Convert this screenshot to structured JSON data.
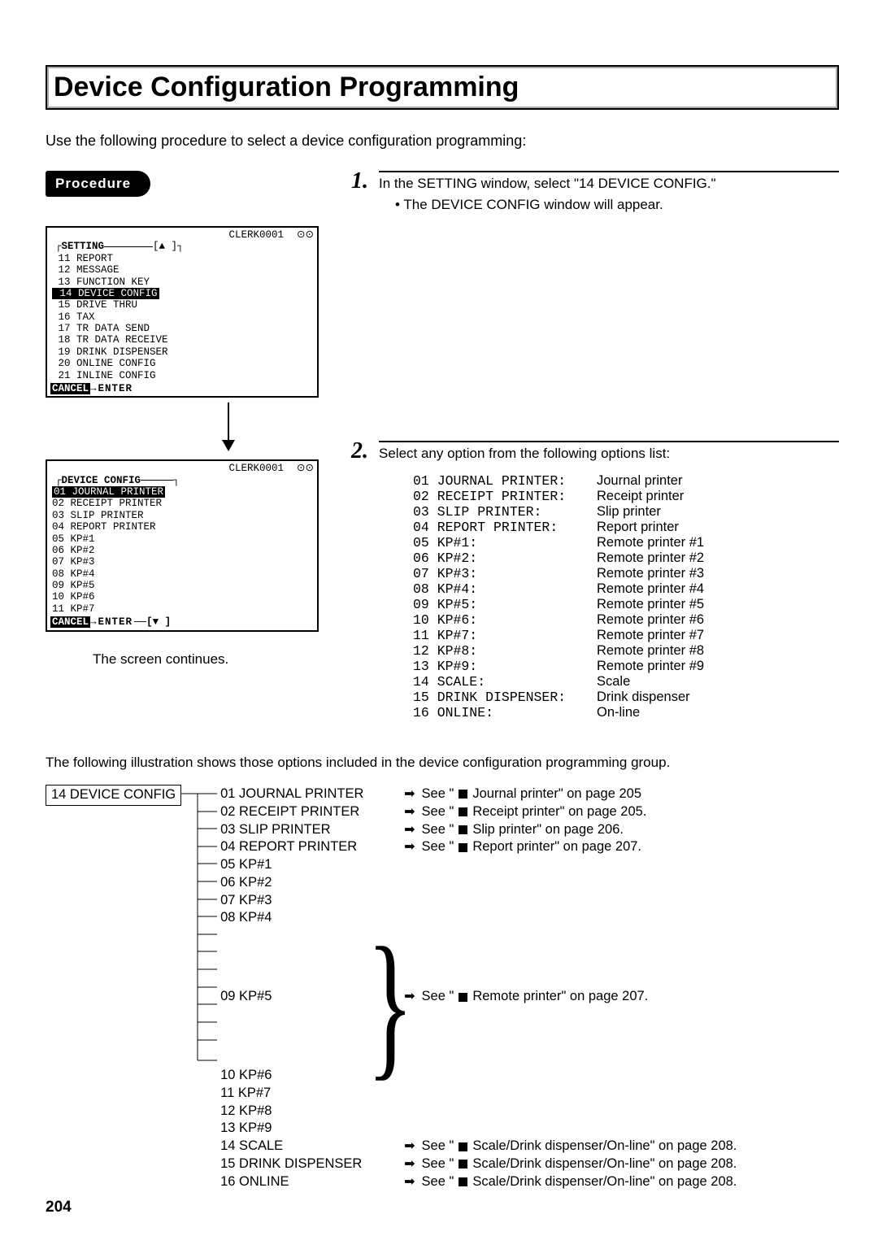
{
  "title": "Device Configuration Programming",
  "intro": "Use the following procedure to select a device configuration programming:",
  "procedure_label": "Procedure",
  "clerk_id": "CLERK0001",
  "rec_icon": "⊙⊙",
  "terminal1": {
    "title": "SETTING",
    "scroll": "[▲ ]",
    "items": [
      "11 REPORT",
      "12 MESSAGE",
      "13 FUNCTION KEY",
      "14 DEVICE CONFIG",
      "15 DRIVE THRU",
      "16 TAX",
      "17 TR DATA SEND",
      "18 TR DATA RECEIVE",
      "19 DRINK DISPENSER",
      "20 ONLINE CONFIG",
      "21 INLINE CONFIG"
    ],
    "selected_index": 3,
    "cancel": "CANCEL",
    "enter": "ENTER"
  },
  "terminal2": {
    "title": "DEVICE CONFIG",
    "scroll": "[▼ ]",
    "items": [
      "01 JOURNAL PRINTER",
      "02 RECEIPT PRINTER",
      "03 SLIP PRINTER",
      "04 REPORT PRINTER",
      "05 KP#1",
      "06 KP#2",
      "07 KP#3",
      "08 KP#4",
      "09 KP#5",
      "10 KP#6",
      "11 KP#7"
    ],
    "selected_index": 0,
    "cancel": "CANCEL",
    "enter": "ENTER"
  },
  "screen_continues": "The screen continues.",
  "step1": {
    "num": "1.",
    "text_a": "In the SETTING window, select \"14 DEVICE CONFIG.\"",
    "bullet": "The DEVICE CONFIG window will appear."
  },
  "step2": {
    "num": "2.",
    "text_a": "Select any option from the following options list:"
  },
  "options": [
    {
      "code": "01 JOURNAL PRINTER:",
      "desc": "Journal printer"
    },
    {
      "code": "02 RECEIPT PRINTER:",
      "desc": "Receipt printer"
    },
    {
      "code": "03 SLIP PRINTER:",
      "desc": "Slip printer"
    },
    {
      "code": "04 REPORT PRINTER:",
      "desc": "Report printer"
    },
    {
      "code": "05 KP#1:",
      "desc": "Remote printer #1"
    },
    {
      "code": "06 KP#2:",
      "desc": "Remote printer #2"
    },
    {
      "code": "07 KP#3:",
      "desc": "Remote printer #3"
    },
    {
      "code": "08 KP#4:",
      "desc": "Remote printer #4"
    },
    {
      "code": "09 KP#5:",
      "desc": "Remote printer #5"
    },
    {
      "code": "10 KP#6:",
      "desc": "Remote printer #6"
    },
    {
      "code": "11 KP#7:",
      "desc": "Remote printer #7"
    },
    {
      "code": "12 KP#8:",
      "desc": "Remote printer #8"
    },
    {
      "code": "13 KP#9:",
      "desc": "Remote printer #9"
    },
    {
      "code": "14 SCALE:",
      "desc": "Scale"
    },
    {
      "code": "15 DRINK DISPENSER:",
      "desc": "Drink dispenser"
    },
    {
      "code": "16 ONLINE:",
      "desc": "On-line"
    }
  ],
  "mid_note": "The following illustration shows those options included in the device configuration programming group.",
  "tree": {
    "root": "14 DEVICE CONFIG",
    "items": [
      "01 JOURNAL PRINTER",
      "02 RECEIPT PRINTER",
      "03 SLIP PRINTER",
      "04 REPORT PRINTER",
      "05 KP#1",
      "06 KP#2",
      "07 KP#3",
      "08 KP#4",
      "09 KP#5",
      "10 KP#6",
      "11 KP#7",
      "12 KP#8",
      "13 KP#9",
      "14 SCALE",
      "15 DRINK DISPENSER",
      "16 ONLINE"
    ],
    "refs": {
      "0": "See \" Journal printer\" on page 205",
      "1": "See \" Receipt printer\" on page 205.",
      "2": "See \" Slip printer\" on page 206.",
      "3": "See \" Report printer\" on page 207.",
      "kp": "See \" Remote printer\" on page 207.",
      "13": "See \" Scale/Drink dispenser/On-line\" on page 208.",
      "14": "See \" Scale/Drink dispenser/On-line\" on page 208.",
      "15": "See \" Scale/Drink dispenser/On-line\" on page 208."
    }
  },
  "page_number": "204"
}
